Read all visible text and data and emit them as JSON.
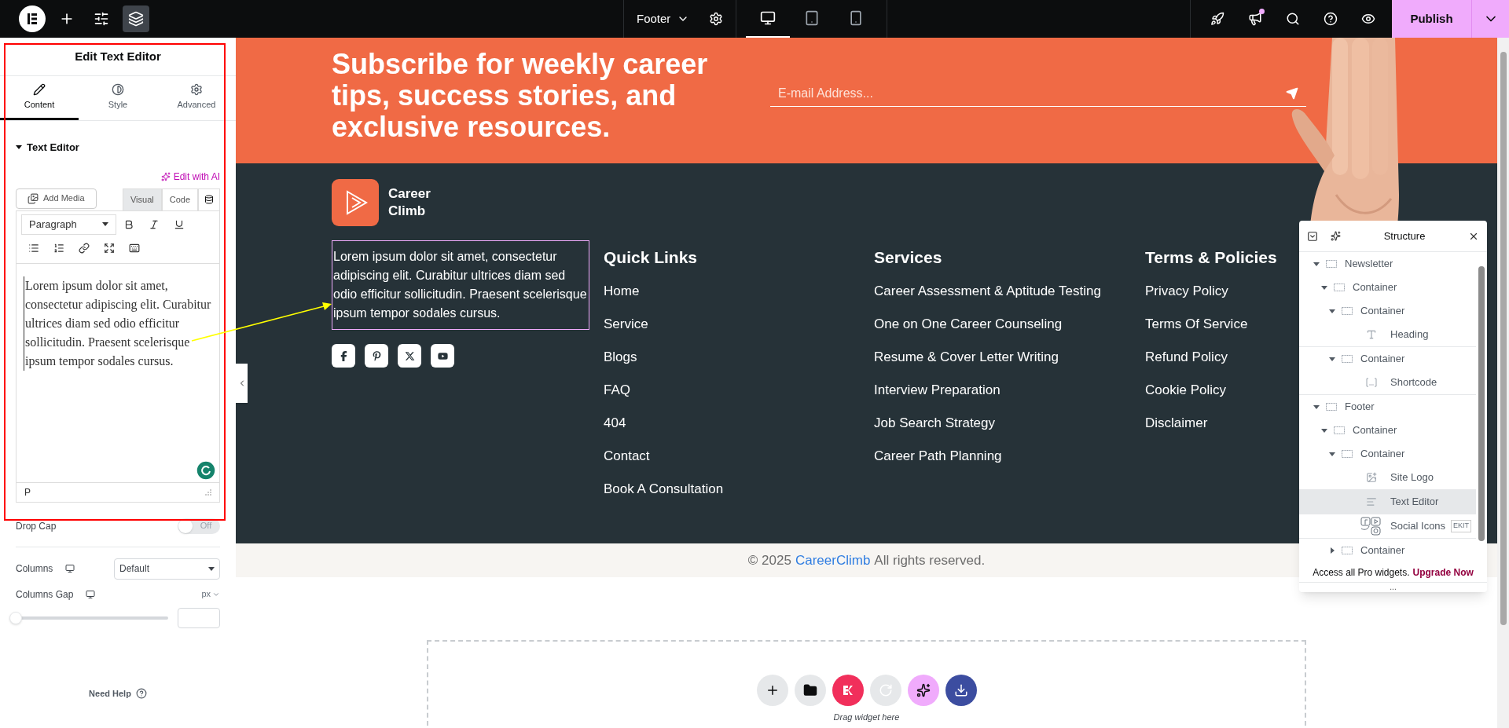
{
  "topbar": {
    "tools": [
      {
        "kind": "add",
        "selected": false
      },
      {
        "kind": "settings",
        "selected": false
      },
      {
        "kind": "structure",
        "selected": true
      }
    ],
    "document": "Footer",
    "devices": [
      {
        "kind": "desktop",
        "selected": true
      },
      {
        "kind": "tablet",
        "selected": false
      },
      {
        "kind": "mobile",
        "selected": false
      }
    ],
    "actions": [
      {
        "kind": "launch",
        "notification": false
      },
      {
        "kind": "whats-new",
        "notification": true
      },
      {
        "kind": "search",
        "notification": false
      },
      {
        "kind": "help",
        "notification": false
      },
      {
        "kind": "preview",
        "notification": false
      }
    ],
    "publish": "Publish"
  },
  "panel": {
    "title": "Edit Text Editor",
    "tabs": [
      {
        "kind": "content",
        "label": "Content",
        "selected": true
      },
      {
        "kind": "style",
        "label": "Style",
        "selected": false
      },
      {
        "kind": "advanced",
        "label": "Advanced",
        "selected": false
      }
    ],
    "section": {
      "title": "Text Editor",
      "expanded": true
    },
    "ai_link": "Edit with AI",
    "add_media": "Add Media",
    "editor_tabs": [
      {
        "label": "Visual",
        "selected": true
      },
      {
        "label": "Code",
        "selected": false
      }
    ],
    "format": "Paragraph",
    "content": "Lorem ipsum dolor sit amet, consectetur adipiscing elit. Curabitur ultrices diam sed odio efficitur sollicitudin. Praesent scelerisque ipsum tempor sodales cursus.",
    "path": "P",
    "drop_cap": {
      "label": "Drop Cap",
      "on": false,
      "state": "Off"
    },
    "columns": {
      "label": "Columns",
      "value": "Default"
    },
    "columns_gap": {
      "label": "Columns Gap",
      "unit": "px",
      "level": 0
    },
    "help": "Need Help"
  },
  "canvas": {
    "newsletter": {
      "heading": "Subscribe for weekly career tips, success stories, and exclusive resources.",
      "email_placeholder": "E-mail Address..."
    },
    "footer": {
      "brand": "Career Climb",
      "about": "Lorem ipsum dolor sit amet, consectetur adipiscing elit. Curabitur ultrices diam sed odio efficitur sollicitudin. Praesent scelerisque ipsum tempor sodales cursus.",
      "about_selected": true,
      "socials": [
        {
          "kind": "facebook"
        },
        {
          "kind": "pinterest"
        },
        {
          "kind": "x"
        },
        {
          "kind": "youtube"
        }
      ],
      "columns": [
        {
          "title": "Quick Links",
          "links": [
            "Home",
            "Service",
            "Blogs",
            "FAQ",
            "404",
            "Contact",
            "Book A Consultation"
          ]
        },
        {
          "title": "Services",
          "links": [
            "Career Assessment & Aptitude Testing",
            "One on One Career Counseling",
            "Resume & Cover Letter Writing",
            "Interview Preparation",
            "Job Search Strategy",
            "Career Path Planning"
          ]
        },
        {
          "title": "Terms & Policies",
          "links": [
            "Privacy Policy",
            "Terms Of Service",
            "Refund Policy",
            "Cookie Policy",
            "Disclaimer"
          ]
        }
      ]
    },
    "copyright": {
      "prefix": "© 2025",
      "link": "CareerClimb",
      "suffix": "All rights reserved."
    },
    "drop_zone": {
      "actions": [
        {
          "kind": "add"
        },
        {
          "kind": "template"
        },
        {
          "kind": "elementskit"
        },
        {
          "kind": "history"
        },
        {
          "kind": "ai"
        },
        {
          "kind": "import"
        }
      ],
      "hint": "Drag widget here"
    }
  },
  "structure": {
    "title": "Structure",
    "tree": [
      {
        "label": "Newsletter",
        "kind": "container",
        "expanded": true,
        "selected": false,
        "children": [
          {
            "label": "Container",
            "kind": "container",
            "expanded": true,
            "selected": false,
            "children": [
              {
                "label": "Container",
                "kind": "container",
                "expanded": true,
                "selected": false,
                "children": [
                  {
                    "label": "Heading",
                    "kind": "heading",
                    "selected": false
                  }
                ]
              },
              {
                "label": "Container",
                "kind": "container",
                "expanded": true,
                "selected": false,
                "children": [
                  {
                    "label": "Shortcode",
                    "kind": "shortcode",
                    "selected": false
                  }
                ]
              }
            ]
          }
        ]
      },
      {
        "label": "Footer",
        "kind": "container",
        "expanded": true,
        "selected": false,
        "children": [
          {
            "label": "Container",
            "kind": "container",
            "expanded": true,
            "selected": false,
            "children": [
              {
                "label": "Container",
                "kind": "container",
                "expanded": true,
                "selected": false,
                "children": [
                  {
                    "label": "Site Logo",
                    "kind": "logo",
                    "selected": false
                  },
                  {
                    "label": "Text Editor",
                    "kind": "text",
                    "selected": true
                  },
                  {
                    "label": "Social Icons",
                    "kind": "social",
                    "selected": false,
                    "badge": "EKIT"
                  }
                ]
              },
              {
                "label": "Container",
                "kind": "container",
                "expanded": false,
                "selected": false
              }
            ]
          }
        ]
      }
    ],
    "promo": {
      "text": "Access all Pro widgets.",
      "link": "Upgrade Now"
    },
    "handle": "..."
  }
}
